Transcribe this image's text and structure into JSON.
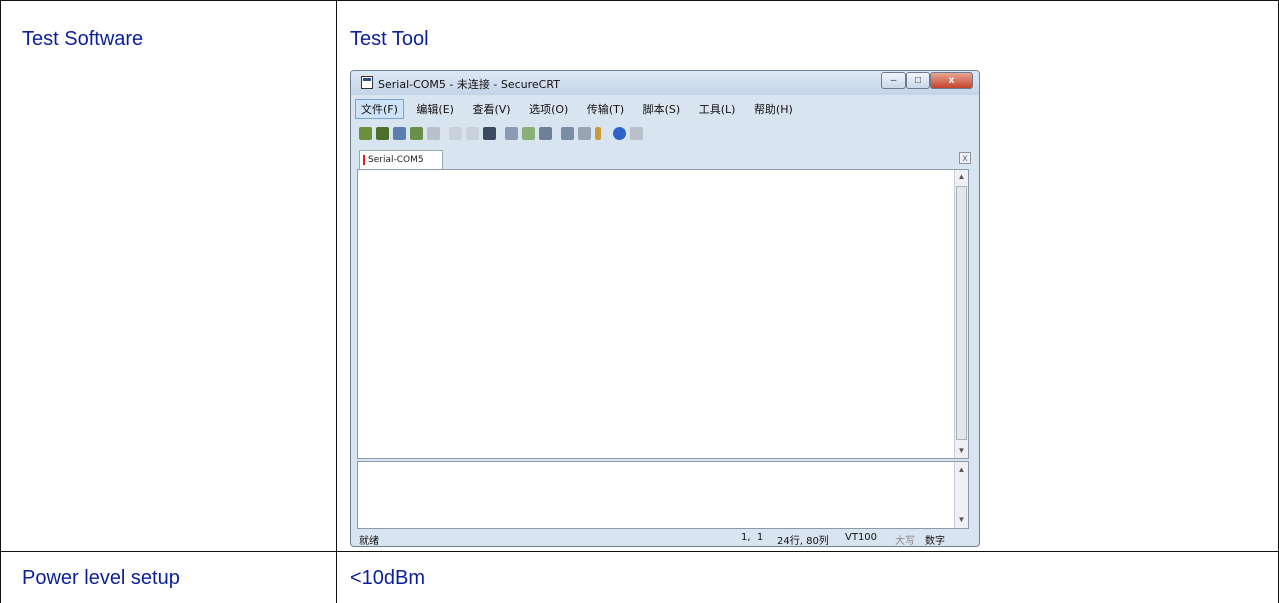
{
  "table": {
    "rows": [
      {
        "label": "Test Software",
        "value": "Test Tool"
      },
      {
        "label": "Power level setup",
        "value": "<10dBm"
      }
    ]
  },
  "window": {
    "title": "Serial-COM5 - 未连接 - SecureCRT",
    "controls": {
      "minimize": "–",
      "maximize": "□",
      "close": "x"
    },
    "menu": [
      "文件(F)",
      "编辑(E)",
      "查看(V)",
      "选项(O)",
      "传输(T)",
      "脚本(S)",
      "工具(L)",
      "帮助(H)"
    ],
    "tab_label": "Serial-COM5",
    "tab_close": "x",
    "status": {
      "left": "就绪",
      "position": "1,  1",
      "size": "24行, 80列",
      "emulation": "VT100",
      "caps": "大写",
      "num": "数字"
    }
  },
  "colors": {
    "cell_text": "#0b1f9c",
    "grid_line": "#111111",
    "window_frame": "#d9e4f1"
  }
}
